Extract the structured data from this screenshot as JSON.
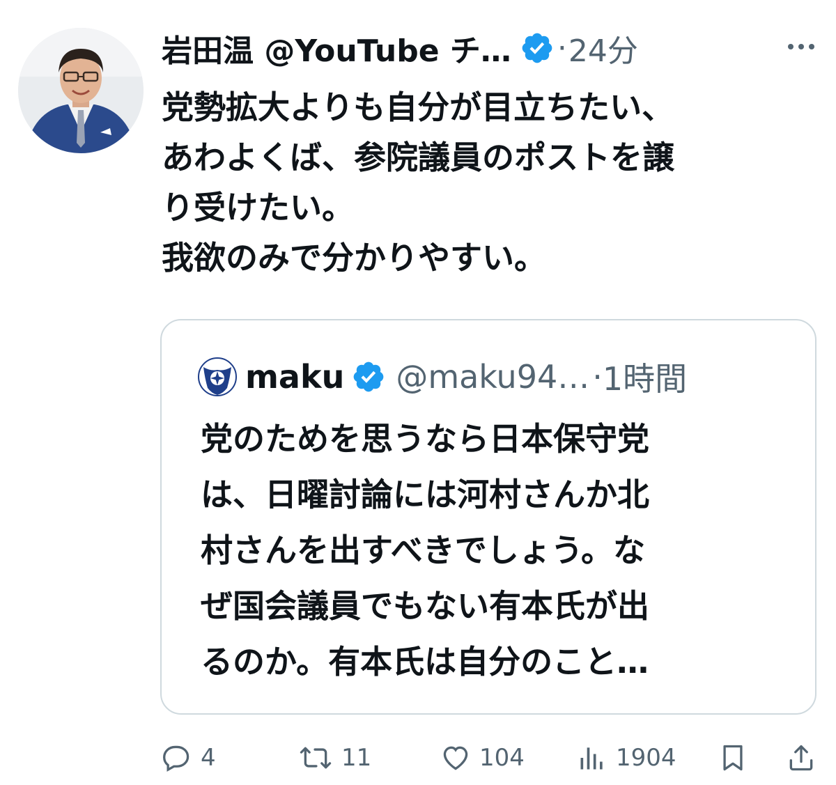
{
  "tweet": {
    "display_name": "岩田温 @YouTube チ…",
    "separator": "·",
    "time": "24分",
    "text_lines": [
      "党勢拡大よりも自分が目立ちたい、",
      "あわよくば、参院議員のポストを譲",
      "り受けたい。",
      "我欲のみで分かりやすい。"
    ]
  },
  "quoted_tweet": {
    "name": "maku",
    "handle": "@maku94…",
    "separator": "·",
    "time": "1時間",
    "text_lines": [
      "党のためを思うなら日本保守党",
      "は、日曜討論には河村さんか北",
      "村さんを出すべきでしょう。な",
      "ぜ国会議員でもない有本氏が出",
      "るのか。有本氏は自分のこと…"
    ]
  },
  "actions": {
    "reply_count": "4",
    "retweet_count": "11",
    "like_count": "104",
    "views_count": "1904"
  },
  "icons": {
    "verified": "verified-badge-icon",
    "more": "more-icon",
    "reply": "reply-icon",
    "retweet": "retweet-icon",
    "like": "like-icon",
    "views": "views-icon",
    "bookmark": "bookmark-icon",
    "share": "share-icon"
  },
  "colors": {
    "verified_blue": "#1d9bf0",
    "secondary_text": "#536471",
    "border": "#cfd9de"
  }
}
